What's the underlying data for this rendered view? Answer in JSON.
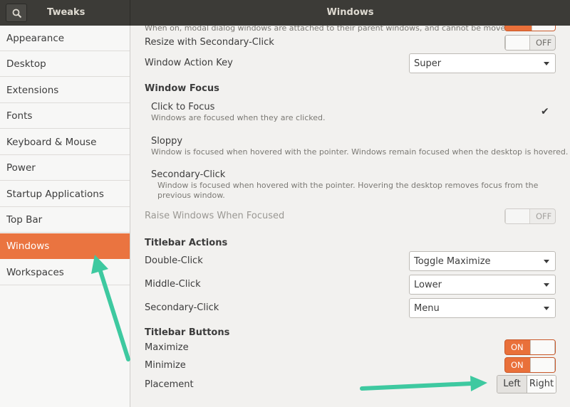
{
  "header": {
    "app_title": "Tweaks",
    "window_title": "Windows"
  },
  "sidebar": {
    "items": [
      {
        "label": "Appearance"
      },
      {
        "label": "Desktop"
      },
      {
        "label": "Extensions"
      },
      {
        "label": "Fonts"
      },
      {
        "label": "Keyboard & Mouse"
      },
      {
        "label": "Power"
      },
      {
        "label": "Startup Applications"
      },
      {
        "label": "Top Bar"
      },
      {
        "label": "Windows",
        "active": true
      },
      {
        "label": "Workspaces"
      }
    ]
  },
  "main": {
    "attach_modal_description": "When on, modal dialog windows are attached to their parent windows, and cannot be moved.",
    "resize_secondary_click": {
      "label": "Resize with Secondary-Click",
      "state": "OFF"
    },
    "window_action_key": {
      "label": "Window Action Key",
      "value": "Super"
    },
    "window_focus": {
      "heading": "Window Focus",
      "options": [
        {
          "title": "Click to Focus",
          "description": "Windows are focused when they are clicked.",
          "selected": true
        },
        {
          "title": "Sloppy",
          "description": "Window is focused when hovered with the pointer. Windows remain focused when the desktop is hovered."
        },
        {
          "title": "Secondary-Click",
          "description": "Window is focused when hovered with the pointer. Hovering the desktop removes focus from the previous window."
        }
      ],
      "check_mark": "✔"
    },
    "raise_windows": {
      "label": "Raise Windows When Focused",
      "state": "OFF"
    },
    "titlebar_actions": {
      "heading": "Titlebar Actions",
      "double_click": {
        "label": "Double-Click",
        "value": "Toggle Maximize"
      },
      "middle_click": {
        "label": "Middle-Click",
        "value": "Lower"
      },
      "secondary_click": {
        "label": "Secondary-Click",
        "value": "Menu"
      }
    },
    "titlebar_buttons": {
      "heading": "Titlebar Buttons",
      "maximize": {
        "label": "Maximize",
        "state": "ON"
      },
      "minimize": {
        "label": "Minimize",
        "state": "ON"
      },
      "placement": {
        "label": "Placement",
        "left": "Left",
        "right": "Right",
        "selected": "Left"
      }
    }
  },
  "colors": {
    "accent": "#ea7440",
    "annotation_arrow": "#3ec9a0",
    "headerbar": "#3c3b37"
  }
}
